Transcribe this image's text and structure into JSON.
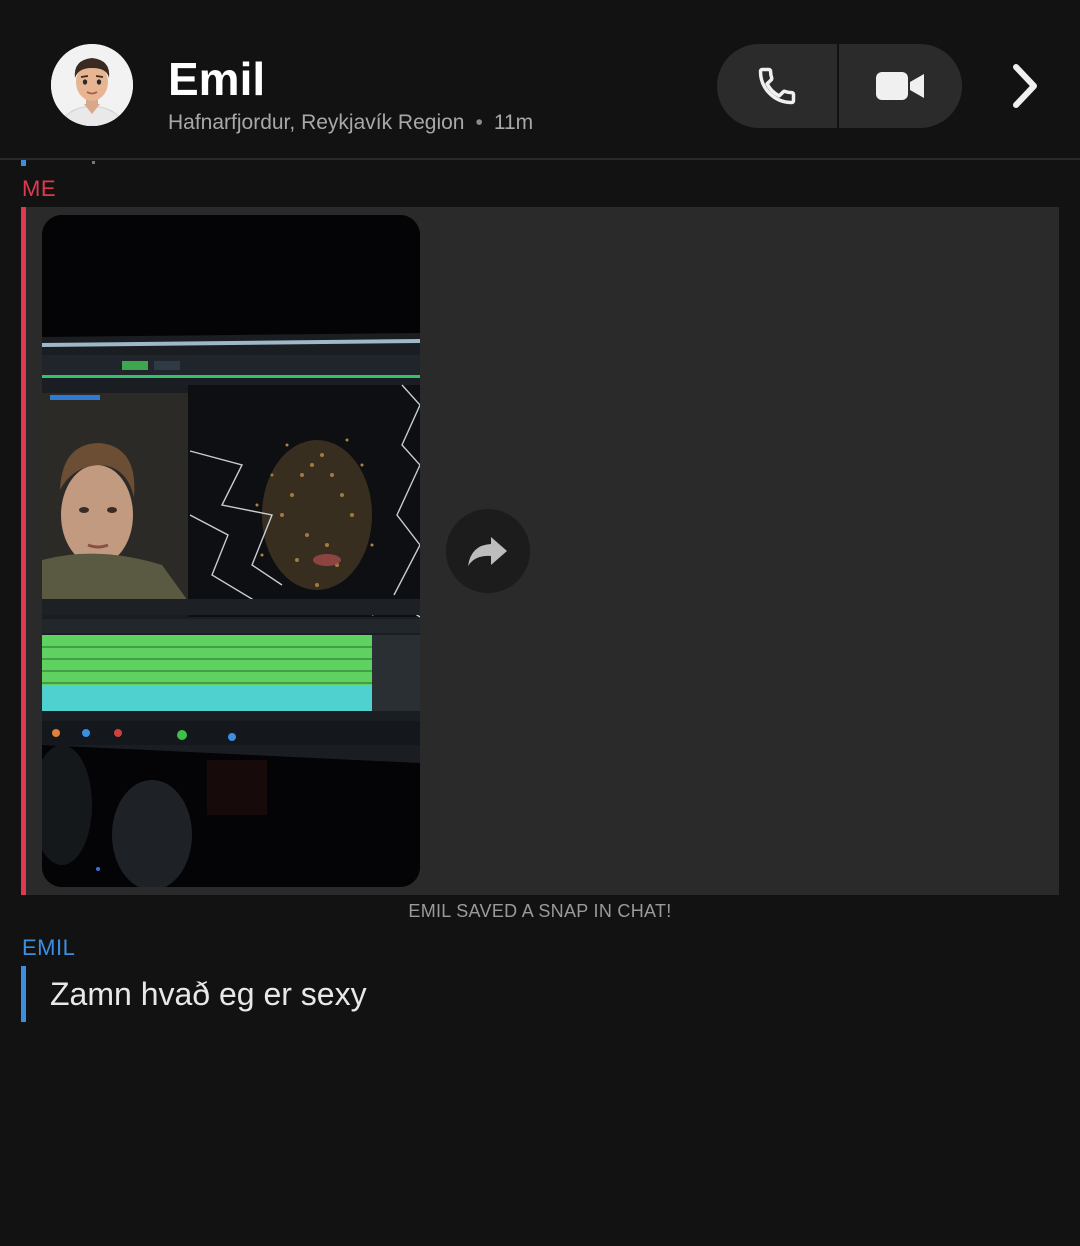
{
  "header": {
    "name": "Emil",
    "location": "Hafnarfjordur, Reykjavík Region",
    "separator": "•",
    "time_ago": "11m",
    "avatar_icon": "bitmoji-avatar",
    "call_icon": "phone-icon",
    "video_icon": "video-camera-icon",
    "more_icon": "chevron-right-icon"
  },
  "chat": {
    "me_label": "ME",
    "emil_label": "EMIL",
    "saved_note": "EMIL SAVED A SNAP IN CHAT!",
    "emil_message": "Zamn hvað eg er sexy",
    "share_icon": "share-arrow-icon"
  },
  "colors": {
    "me_accent": "#e0394f",
    "emil_accent": "#3b8fe0",
    "background": "#121212",
    "snap_block": "#2a2a2a"
  }
}
